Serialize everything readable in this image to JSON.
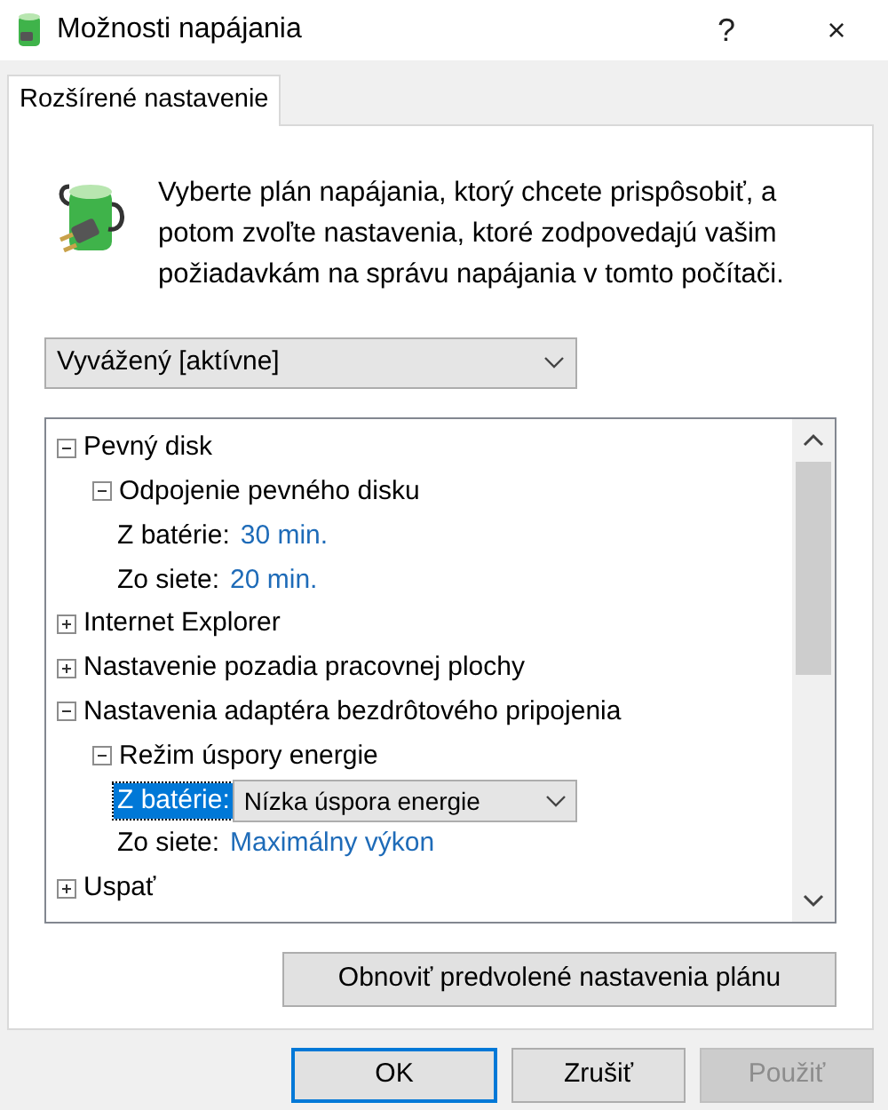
{
  "window": {
    "title": "Možnosti napájania",
    "help": "?",
    "close": "×"
  },
  "tabs": [
    {
      "label": "Rozšírené nastavenie",
      "selected": true
    }
  ],
  "intro": "Vyberte plán napájania, ktorý chcete prispôsobiť, a potom zvoľte nastavenia, ktoré zodpovedajú vašim požiadavkám na správu napájania v tomto počítači.",
  "plan": {
    "value": "Vyvážený [aktívne]"
  },
  "tree": [
    {
      "label": "Pevný disk",
      "expanded": true,
      "children": [
        {
          "label": "Odpojenie pevného disku",
          "expanded": true,
          "children": [
            {
              "kind": "setting",
              "label": "Z batérie:",
              "value": "30 min.",
              "selected": false
            },
            {
              "kind": "setting",
              "label": "Zo siete:",
              "value": "20 min.",
              "selected": false
            }
          ]
        }
      ]
    },
    {
      "label": "Internet Explorer",
      "expanded": false
    },
    {
      "label": "Nastavenie pozadia pracovnej plochy",
      "expanded": false
    },
    {
      "label": "Nastavenia adaptéra bezdrôtového pripojenia",
      "expanded": true,
      "children": [
        {
          "label": "Režim úspory energie",
          "expanded": true,
          "children": [
            {
              "kind": "dropdown",
              "label": "Z batérie:",
              "value": "Nízka úspora energie",
              "selected": true
            },
            {
              "kind": "setting",
              "label": "Zo siete:",
              "value": "Maximálny výkon",
              "selected": false
            }
          ]
        }
      ]
    },
    {
      "label": "Uspať",
      "expanded": false
    }
  ],
  "reset_button": "Obnoviť predvolené nastavenia plánu",
  "buttons": [
    {
      "label": "OK",
      "default": true,
      "disabled": false
    },
    {
      "label": "Zrušiť",
      "default": false,
      "disabled": false
    },
    {
      "label": "Použiť",
      "default": false,
      "disabled": true
    }
  ]
}
